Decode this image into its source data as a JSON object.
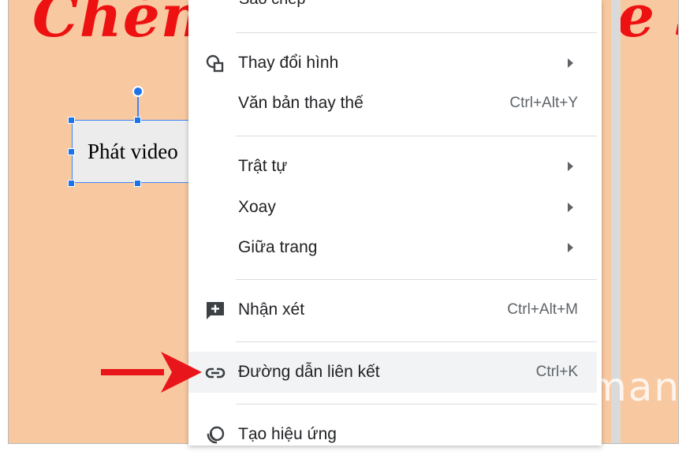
{
  "slide": {
    "title_left": "Chèn v",
    "title_right": "e S",
    "textbox_text": "Phát video"
  },
  "menu": {
    "cut_off_item": "Sao chép",
    "items": [
      {
        "label": "Thay đổi hình",
        "shortcut": "",
        "icon": "replace-image-icon",
        "submenu": true
      },
      {
        "label": "Văn bản thay thế",
        "shortcut": "Ctrl+Alt+Y",
        "icon": "",
        "submenu": false
      },
      {
        "label": "Trật tự",
        "shortcut": "",
        "icon": "",
        "submenu": true
      },
      {
        "label": "Xoay",
        "shortcut": "",
        "icon": "",
        "submenu": true
      },
      {
        "label": "Giữa trang",
        "shortcut": "",
        "icon": "",
        "submenu": true
      },
      {
        "label": "Nhận xét",
        "shortcut": "Ctrl+Alt+M",
        "icon": "add-comment-icon",
        "submenu": false
      },
      {
        "label": "Đường dẫn liên kết",
        "shortcut": "Ctrl+K",
        "icon": "link-icon",
        "submenu": false,
        "highlighted": true
      },
      {
        "label": "Tạo hiệu ứng",
        "shortcut": "",
        "icon": "animation-icon",
        "submenu": false
      }
    ]
  },
  "watermark": {
    "text": "uantrimang"
  },
  "colors": {
    "slide_background": "#f8c9a0",
    "title_red": "#ee1111",
    "selection_blue": "#1a73e8",
    "pointer_arrow_red": "#e8161b",
    "menu_highlight": "#f1f3f4"
  }
}
